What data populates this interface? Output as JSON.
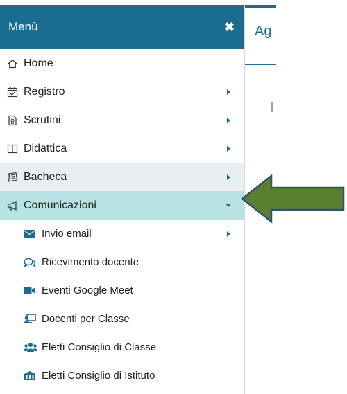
{
  "sidebar": {
    "title": "Menù",
    "close_symbol": "✖",
    "items": [
      {
        "label": "Home",
        "icon": "home-icon",
        "has_caret": false
      },
      {
        "label": "Registro",
        "icon": "calendar-check-icon",
        "has_caret": true
      },
      {
        "label": "Scrutini",
        "icon": "document-icon",
        "has_caret": true
      },
      {
        "label": "Didattica",
        "icon": "book-icon",
        "has_caret": true
      },
      {
        "label": "Bacheca",
        "icon": "newspaper-icon",
        "has_caret": true,
        "state": "hover"
      },
      {
        "label": "Comunicazioni",
        "icon": "megaphone-icon",
        "has_caret": true,
        "state": "active",
        "expanded": true
      }
    ],
    "subitems": [
      {
        "label": "Invio email",
        "icon": "envelope-icon",
        "has_caret": true
      },
      {
        "label": "Ricevimento docente",
        "icon": "comments-icon",
        "has_caret": false
      },
      {
        "label": "Eventi Google Meet",
        "icon": "video-icon",
        "has_caret": false
      },
      {
        "label": "Docenti per Classe",
        "icon": "chalkboard-icon",
        "has_caret": false
      },
      {
        "label": "Eletti Consiglio di Classe",
        "icon": "users-icon",
        "has_caret": false
      },
      {
        "label": "Eletti Consiglio di Istituto",
        "icon": "building-icon",
        "has_caret": false
      }
    ]
  },
  "content": {
    "tab_label": "Ag"
  },
  "colors": {
    "header": "#1a6d8f",
    "active_bg": "#b9e3e3",
    "hover_bg": "#e9eef1",
    "arrow_fill": "#5a7f2e",
    "arrow_stroke": "#2f4f73"
  }
}
